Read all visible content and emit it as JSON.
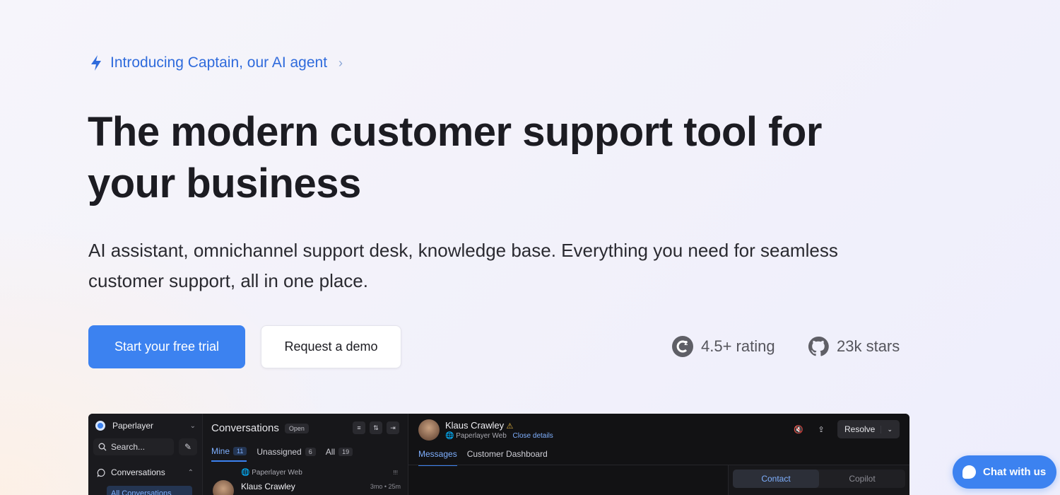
{
  "announcement": {
    "text": "Introducing Captain, our AI agent",
    "icon": "lightning-bolt-icon",
    "chevron": "›"
  },
  "hero": {
    "title": "The modern customer support tool for your business",
    "subtitle": "AI assistant, omnichannel support desk, knowledge base. Everything you need for seamless customer support, all in one place."
  },
  "cta": {
    "primary": "Start your free trial",
    "secondary": "Request a demo"
  },
  "stats": [
    {
      "icon": "g2-icon",
      "label": "4.5+ rating"
    },
    {
      "icon": "github-icon",
      "label": "23k stars"
    }
  ],
  "app": {
    "sidebar": {
      "workspace": "Paperlayer",
      "search_placeholder": "Search...",
      "nav_conversations": "Conversations",
      "nav_all_conversations": "All Conversations"
    },
    "list": {
      "title": "Conversations",
      "status_pill": "Open",
      "tabs": [
        {
          "label": "Mine",
          "count": "11"
        },
        {
          "label": "Unassigned",
          "count": "6"
        },
        {
          "label": "All",
          "count": "19"
        }
      ],
      "items": [
        {
          "inbox": "Paperlayer Web",
          "name": "Klaus Crawley",
          "time": "3mo • 25m",
          "priority": "!!!"
        }
      ]
    },
    "conversation": {
      "contact_name": "Klaus Crawley",
      "inbox": "Paperlayer Web",
      "close_details": "Close details",
      "resolve": "Resolve",
      "tabs": [
        "Messages",
        "Customer Dashboard"
      ],
      "panel_tabs": [
        "Contact",
        "Copilot"
      ]
    }
  },
  "chat_widget": {
    "label": "Chat with us"
  },
  "colors": {
    "accent": "#3c82f0",
    "link": "#2f6bdc",
    "app_bg": "#121214",
    "warning": "#e3b341"
  }
}
